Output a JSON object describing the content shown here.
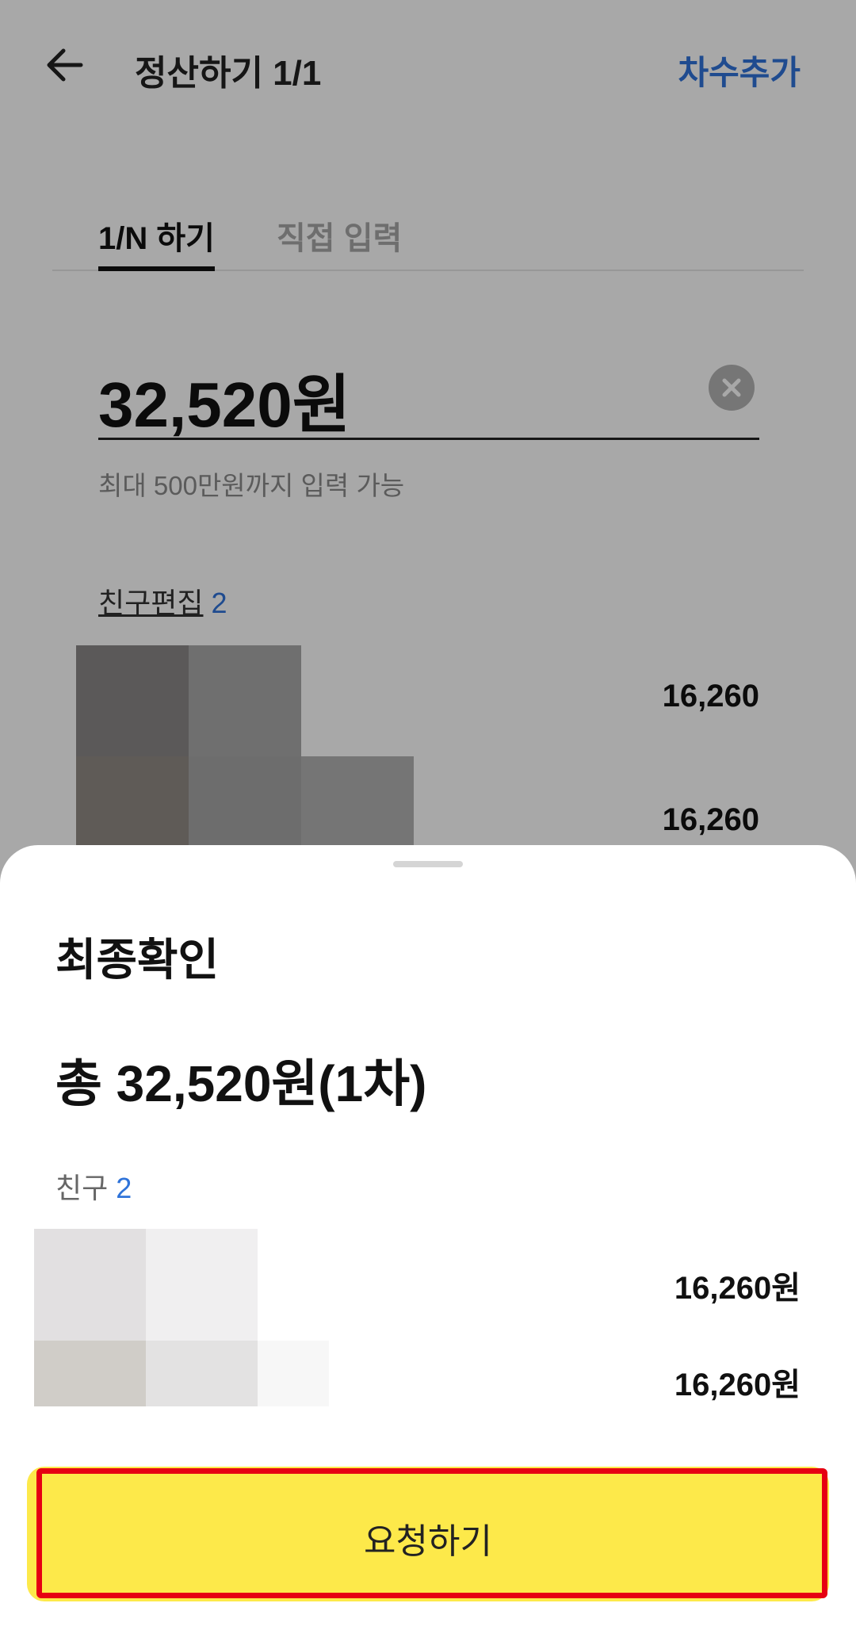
{
  "appbar": {
    "title": "정산하기 1/1",
    "add_round_label": "차수추가",
    "back_icon": "arrow-left-icon"
  },
  "card": {
    "tabs": [
      {
        "label": "1/N 하기",
        "selected": true
      },
      {
        "label": "직접 입력",
        "selected": false
      }
    ],
    "amount_value": "32,520원",
    "clear_icon": "clear-circle-icon",
    "limit_note": "최대 500만원까지 입력 가능",
    "friends_edit_label": "친구편집",
    "friends_edit_count": "2",
    "friend_amounts": [
      "16,260",
      "16,260"
    ]
  },
  "sheet": {
    "title": "최종확인",
    "total": "총 32,520원(1차)",
    "friends_label": "친구",
    "friends_count": "2",
    "friend_amounts": [
      "16,260원",
      "16,260원"
    ],
    "request_button_label": "요청하기"
  },
  "colors": {
    "accent_blue": "#2f73d9",
    "button_yellow": "#fde94a",
    "highlight_red": "#e60012"
  }
}
